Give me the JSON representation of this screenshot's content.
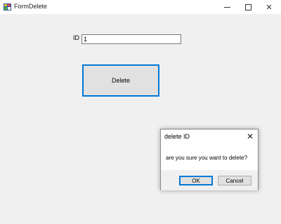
{
  "window": {
    "title": "FormDelete",
    "icons": {
      "app": "form-app-icon",
      "minimize": "minimize-icon",
      "maximize": "maximize-icon",
      "close": "close-icon"
    },
    "close_glyph": "✕"
  },
  "form": {
    "id_label": "ID",
    "id_value": "1",
    "delete_button": "Delete"
  },
  "dialog": {
    "title": "delete ID",
    "close_glyph": "✕",
    "message": "are you sure you want to delete?",
    "ok_label": "OK",
    "cancel_label": "Cancel"
  },
  "colors": {
    "accent": "#0078d7",
    "background": "#f0f0f0"
  }
}
